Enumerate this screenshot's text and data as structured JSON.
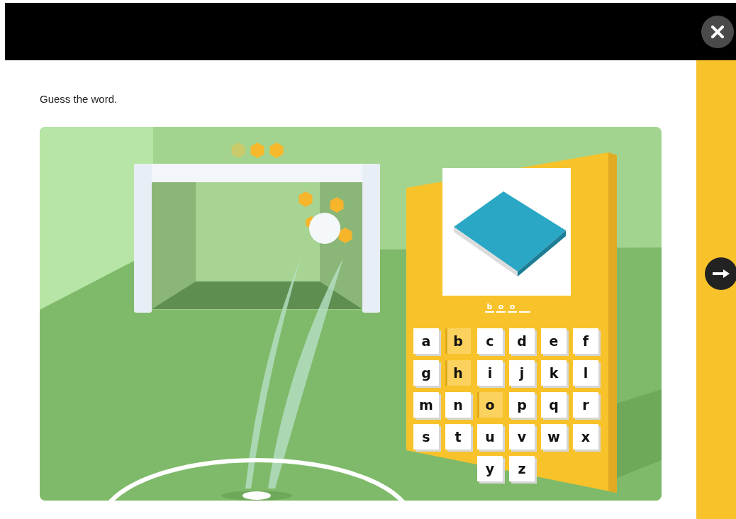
{
  "instruction": "Guess the word.",
  "lives": [
    {
      "on": false
    },
    {
      "on": true
    },
    {
      "on": true
    }
  ],
  "slots": [
    {
      "letter": "b",
      "filled": true
    },
    {
      "letter": "o",
      "filled": true
    },
    {
      "letter": "o",
      "filled": true
    },
    {
      "filled": false
    }
  ],
  "keys": [
    {
      "letter": "a",
      "used": false
    },
    {
      "letter": "b",
      "used": true
    },
    {
      "letter": "c",
      "used": false
    },
    {
      "letter": "d",
      "used": false
    },
    {
      "letter": "e",
      "used": false
    },
    {
      "letter": "f",
      "used": false
    },
    {
      "letter": "g",
      "used": false
    },
    {
      "letter": "h",
      "used": true
    },
    {
      "letter": "i",
      "used": false
    },
    {
      "letter": "j",
      "used": false
    },
    {
      "letter": "k",
      "used": false
    },
    {
      "letter": "l",
      "used": false
    },
    {
      "letter": "m",
      "used": false
    },
    {
      "letter": "n",
      "used": false
    },
    {
      "letter": "o",
      "used": true
    },
    {
      "letter": "p",
      "used": false
    },
    {
      "letter": "q",
      "used": false
    },
    {
      "letter": "r",
      "used": false
    },
    {
      "letter": "s",
      "used": false
    },
    {
      "letter": "t",
      "used": false
    },
    {
      "letter": "u",
      "used": false
    },
    {
      "letter": "v",
      "used": false
    },
    {
      "letter": "w",
      "used": false
    },
    {
      "letter": "x",
      "used": false
    },
    {
      "letter": "y",
      "used": false
    },
    {
      "letter": "z",
      "used": false
    }
  ]
}
